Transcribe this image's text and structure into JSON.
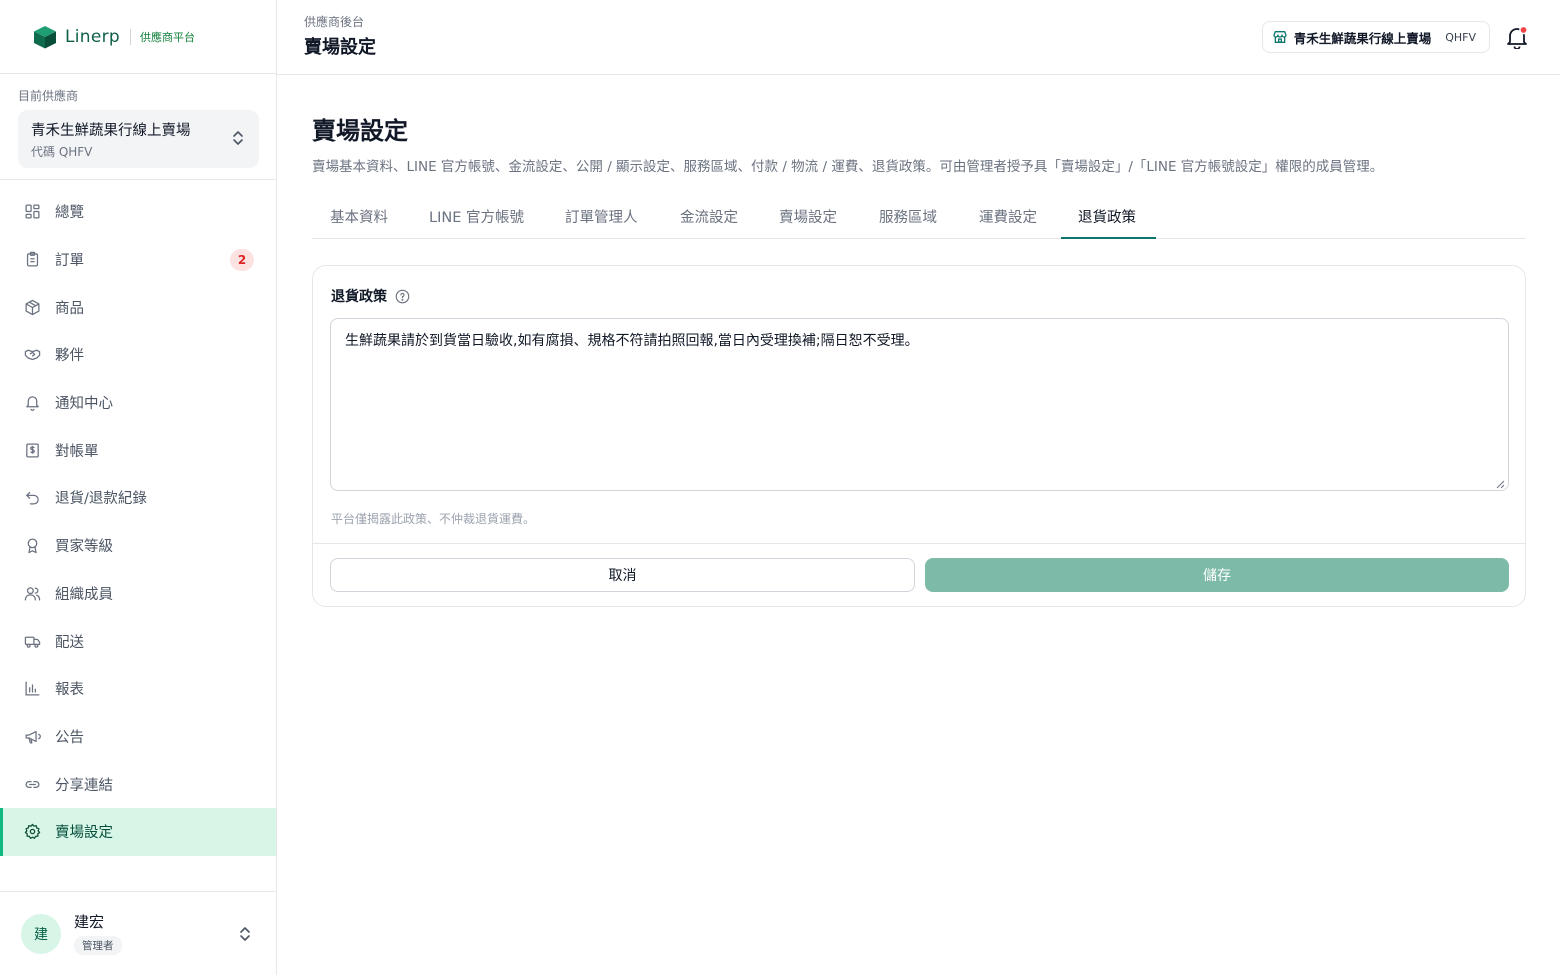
{
  "brand": {
    "name": "Linerp",
    "subtitle": "供應商平台",
    "brand_color": "#0f5f49"
  },
  "supplier": {
    "label": "目前供應商",
    "name": "青禾生鮮蔬果行線上賣場",
    "code": "代碼 QHFV"
  },
  "nav": {
    "items": [
      {
        "label": "總覽",
        "icon": "grid-icon"
      },
      {
        "label": "訂單",
        "icon": "clipboard-icon",
        "badge": "2"
      },
      {
        "label": "商品",
        "icon": "box-icon"
      },
      {
        "label": "夥伴",
        "icon": "handshake-icon"
      },
      {
        "label": "通知中心",
        "icon": "bell-icon"
      },
      {
        "label": "對帳單",
        "icon": "invoice-icon"
      },
      {
        "label": "退貨/退款紀錄",
        "icon": "undo-icon"
      },
      {
        "label": "買家等級",
        "icon": "award-icon"
      },
      {
        "label": "組織成員",
        "icon": "users-icon"
      },
      {
        "label": "配送",
        "icon": "truck-icon"
      },
      {
        "label": "報表",
        "icon": "bar-chart-icon"
      },
      {
        "label": "公告",
        "icon": "megaphone-icon"
      },
      {
        "label": "分享連結",
        "icon": "link-icon"
      },
      {
        "label": "賣場設定",
        "icon": "gear-icon",
        "active": true
      }
    ],
    "active_color": "#d7f6e8"
  },
  "user": {
    "avatar": "建",
    "name": "建宏",
    "role": "管理者"
  },
  "topbar": {
    "breadcrumb": "供應商後台",
    "title": "賣場設定",
    "store_name": "青禾生鮮蔬果行線上賣場",
    "store_code": "QHFV",
    "notification_dot_color": "#ef4444"
  },
  "page": {
    "title": "賣場設定",
    "description": "賣場基本資料、LINE 官方帳號、金流設定、公開 / 顯示設定、服務區域、付款 / 物流 / 運費、退貨政策。可由管理者授予具「賣場設定」/「LINE 官方帳號設定」權限的成員管理。",
    "tabs": [
      "基本資料",
      "LINE 官方帳號",
      "訂單管理人",
      "金流設定",
      "賣場設定",
      "服務區域",
      "運費設定",
      "退貨政策"
    ],
    "active_tab": "退貨政策"
  },
  "form": {
    "label": "退貨政策",
    "value": "生鮮蔬果請於到貨當日驗收,如有腐損、規格不符請拍照回報,當日內受理換補;隔日恕不受理。",
    "hint": "平台僅揭露此政策、不仲裁退貨運費。",
    "cancel_label": "取消",
    "save_label": "儲存",
    "save_color": "#7dbba8"
  }
}
